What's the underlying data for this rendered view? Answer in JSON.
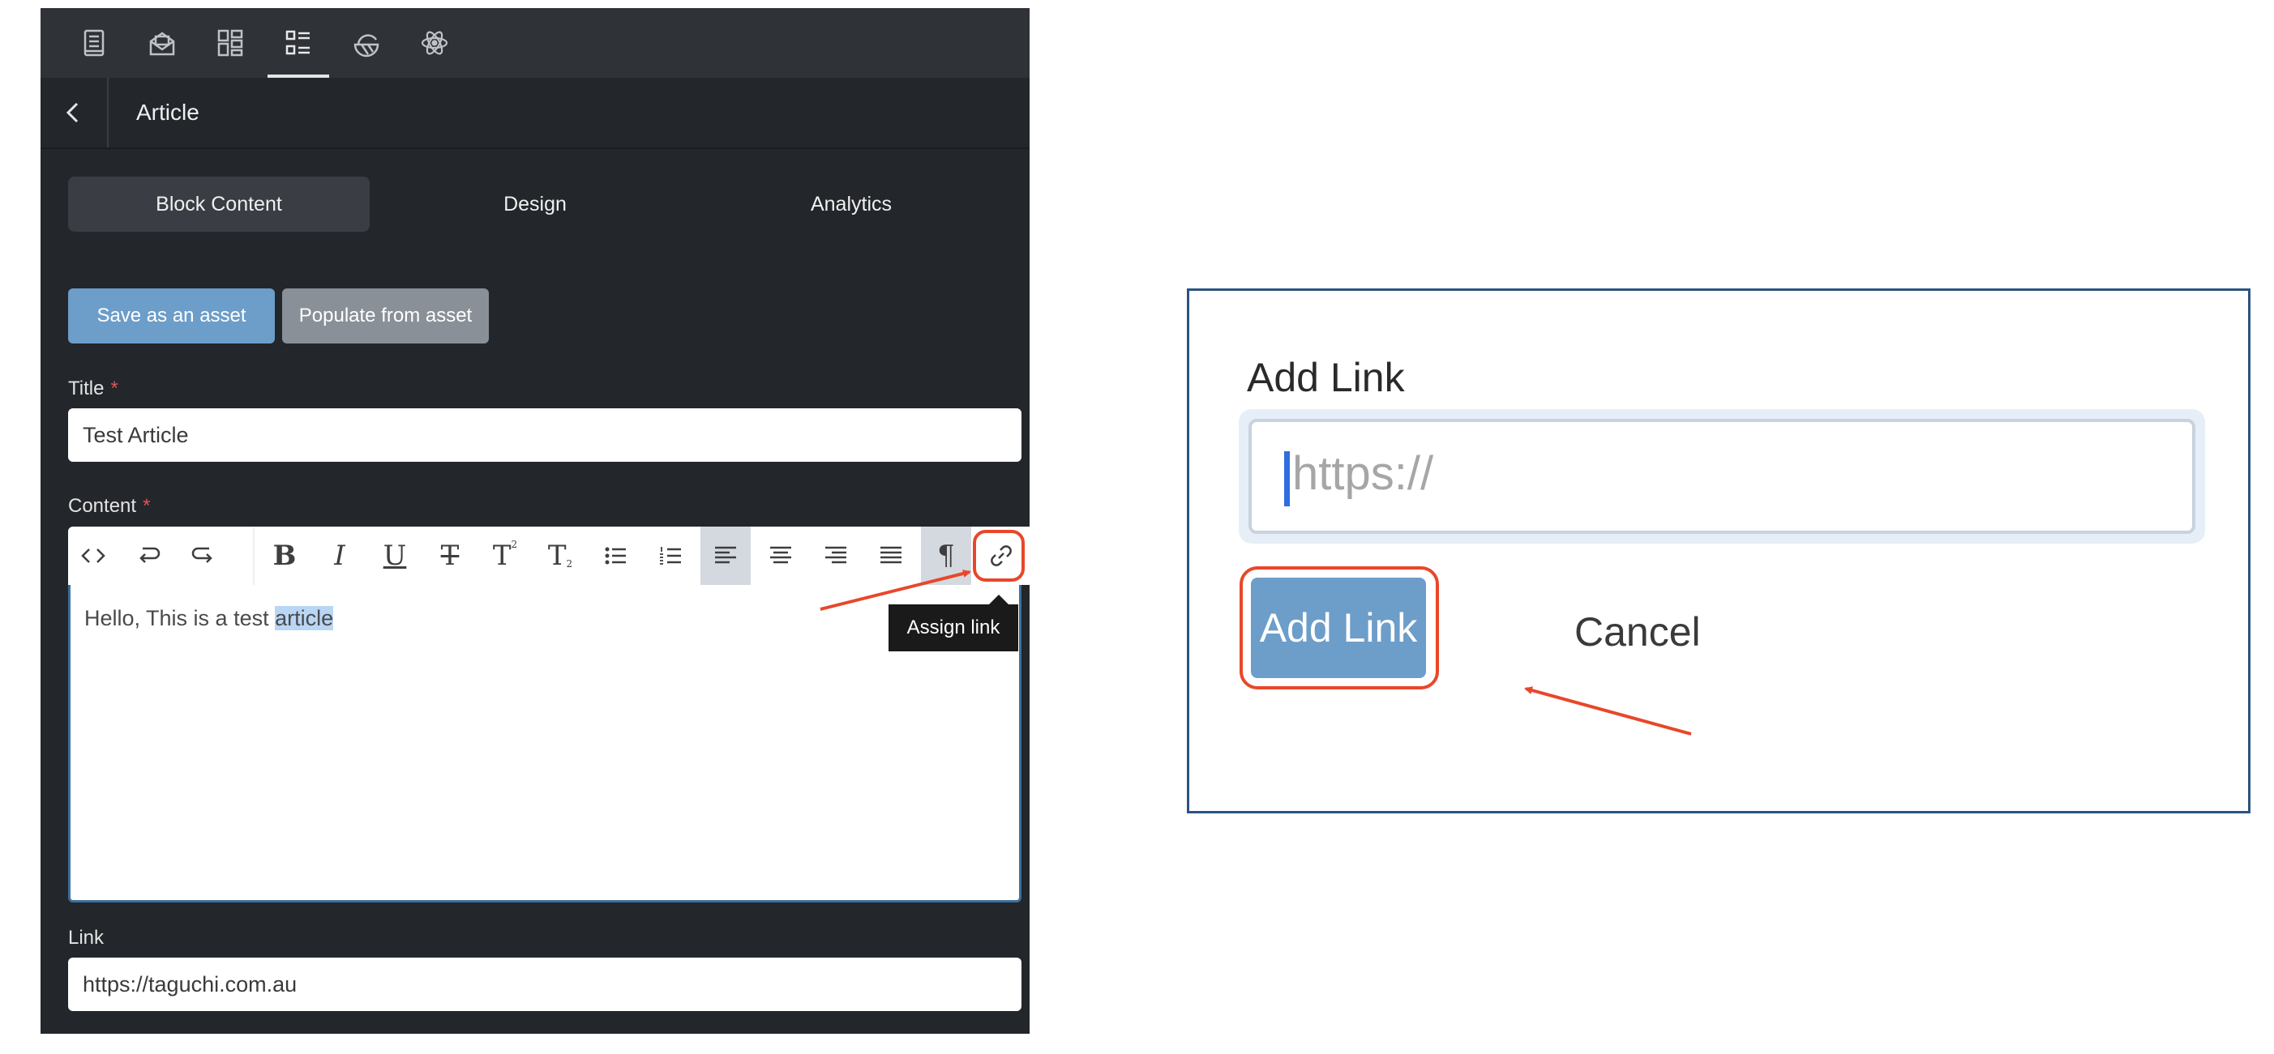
{
  "panel": {
    "top_tabs": [
      {
        "icon": "page-icon"
      },
      {
        "icon": "envelope-icon"
      },
      {
        "icon": "layout-icon"
      },
      {
        "icon": "list-icon",
        "active": true
      },
      {
        "icon": "segment-icon"
      },
      {
        "icon": "atom-icon"
      }
    ],
    "header": {
      "back_icon": "chevron-left-icon",
      "title": "Article"
    },
    "section_tabs": [
      {
        "label": "Block Content",
        "active": true
      },
      {
        "label": "Design"
      },
      {
        "label": "Analytics"
      }
    ],
    "actions": {
      "save_asset": "Save as an asset",
      "populate_asset": "Populate from asset"
    },
    "title_field": {
      "label": "Title",
      "required": "*",
      "value": "Test Article"
    },
    "content_field": {
      "label": "Content",
      "required": "*",
      "text_before": "Hello, This is a test ",
      "selected_text": "article",
      "toolbar": [
        {
          "name": "source-code",
          "icon": "code-icon"
        },
        {
          "name": "undo",
          "icon": "undo-icon"
        },
        {
          "name": "redo",
          "icon": "redo-icon"
        },
        {
          "name": "bold",
          "glyph": "B"
        },
        {
          "name": "italic",
          "glyph": "I"
        },
        {
          "name": "underline",
          "glyph": "U"
        },
        {
          "name": "strikethrough",
          "glyph": "T"
        },
        {
          "name": "superscript",
          "glyph": "T"
        },
        {
          "name": "subscript",
          "glyph": "T"
        },
        {
          "name": "bullet-list",
          "icon": "bullet-list-icon"
        },
        {
          "name": "numbered-list",
          "icon": "numbered-list-icon"
        },
        {
          "name": "align-left",
          "icon": "align-left-icon",
          "active": true
        },
        {
          "name": "align-center",
          "icon": "align-center-icon"
        },
        {
          "name": "align-right",
          "icon": "align-right-icon"
        },
        {
          "name": "justify",
          "icon": "justify-icon"
        },
        {
          "name": "paragraph",
          "glyph": "¶",
          "active": true
        },
        {
          "name": "assign-link",
          "icon": "link-icon"
        }
      ],
      "tooltip": "Assign link"
    },
    "link_field": {
      "label": "Link",
      "value": "https://taguchi.com.au"
    }
  },
  "dialog": {
    "title": "Add Link",
    "url_placeholder": "https://",
    "add_button": "Add Link",
    "cancel_button": "Cancel"
  },
  "colors": {
    "panel_bg": "#23262b",
    "primary_button": "#6d9dc9",
    "secondary_button": "#8a9097",
    "annotation": "#e8472a",
    "selection": "#b9d6f5"
  }
}
